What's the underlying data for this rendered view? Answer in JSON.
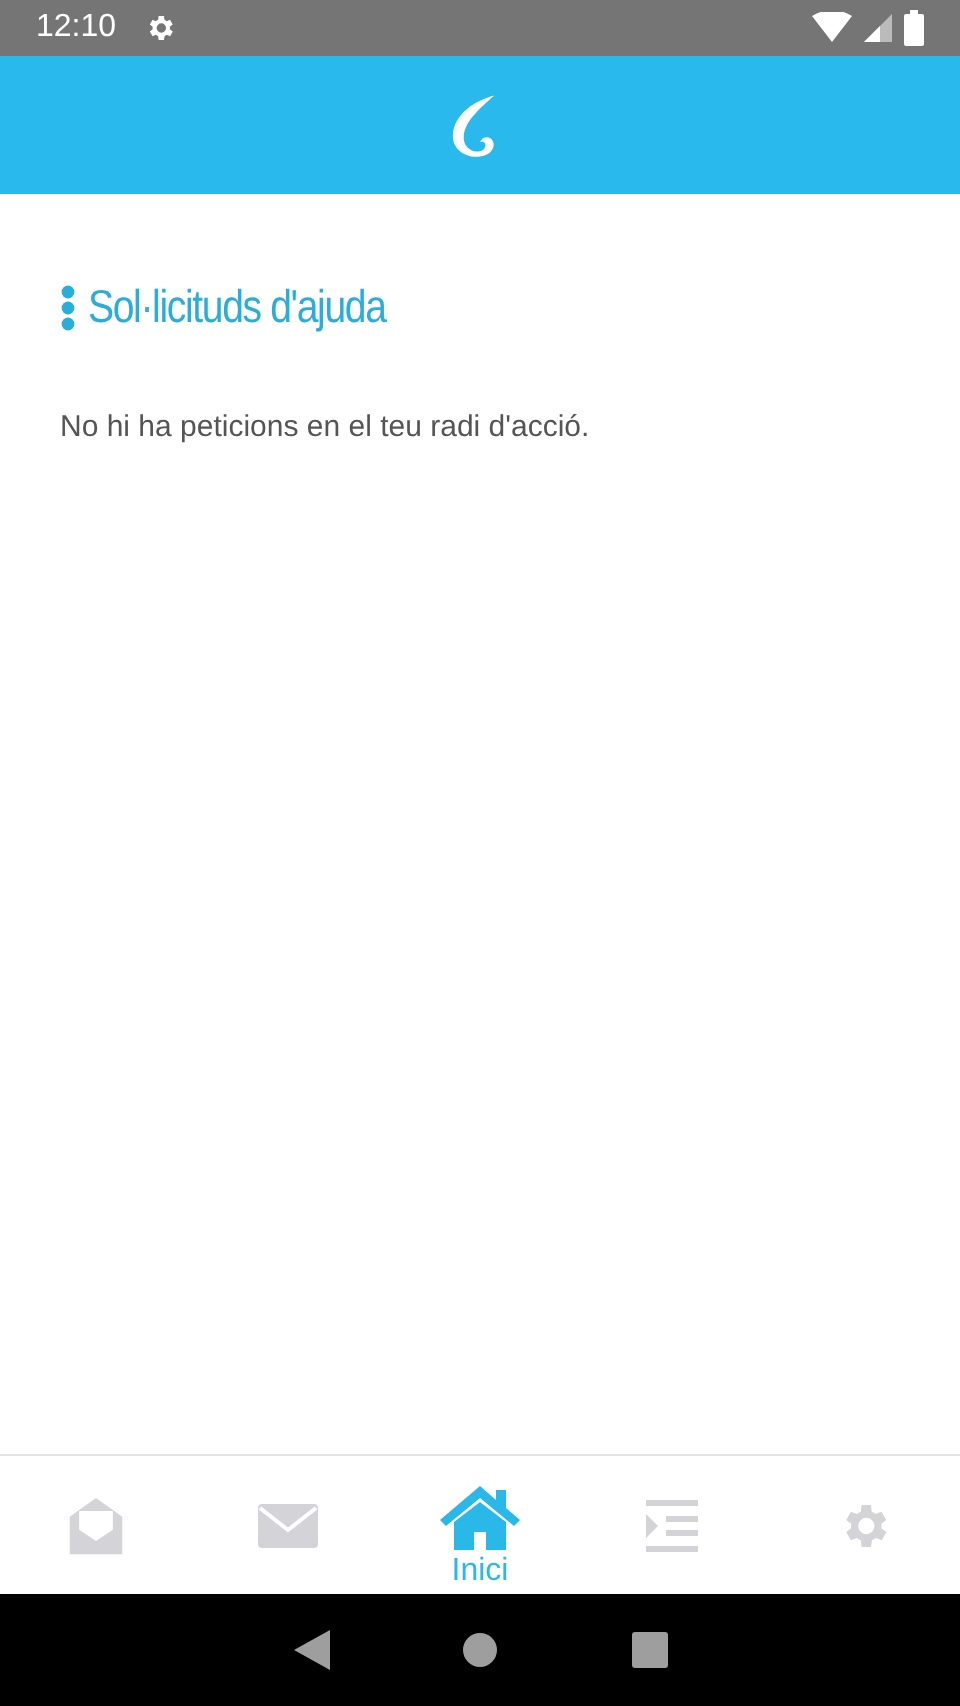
{
  "status_bar": {
    "time": "12:10"
  },
  "section": {
    "title": "Sol·licituds d'ajuda",
    "message": "No hi ha peticions en el teu radi d'acció."
  },
  "bottom_nav": [
    {
      "kind": "letter",
      "selected": false
    },
    {
      "kind": "mail",
      "selected": false
    },
    {
      "kind": "home",
      "selected": true,
      "label": "Inici"
    },
    {
      "kind": "indent",
      "selected": false
    },
    {
      "kind": "gear",
      "selected": false
    }
  ]
}
